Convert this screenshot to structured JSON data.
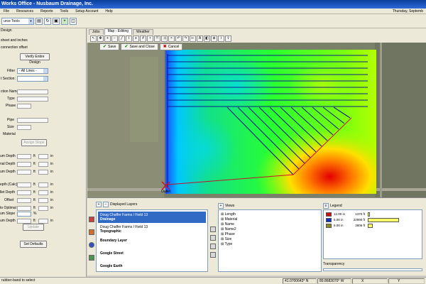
{
  "window": {
    "title": "Works Office - Nusbaum Drainage, Inc."
  },
  "menu": {
    "items": [
      "File",
      "Resources",
      "Reports",
      "Tools",
      "Setup Account",
      "Help"
    ],
    "date": "Thursday, Septemb"
  },
  "toolbar": {
    "dropdown_value": "urce Tools"
  },
  "left_panel": {
    "design_label": "Design",
    "sheet_label": "sheet and inches",
    "connection_label": "connection offset",
    "verify_button": "Verify Entire Design",
    "filter_label": "Filter",
    "filter_value": "- All Lines -",
    "section_label": "t Section:",
    "section_name_label": "ction Name:",
    "type_label": "Type",
    "phase_label": "Phase",
    "pipe_label": "Pipe",
    "size_label": "Size",
    "material_label": "Material",
    "assign_button": "Assign Slope",
    "rows": [
      {
        "label": "um Depth",
        "unit1": "ft",
        "unit2": "in"
      },
      {
        "label": "nal Depth",
        "unit1": "ft",
        "unit2": "in"
      },
      {
        "label": "um Depth",
        "unit1": "ft",
        "unit2": "in"
      },
      {
        "label": "epth (Calc)",
        "unit1": "ft",
        "unit2": "in"
      },
      {
        "label": "llet Depth",
        "unit1": "ft",
        "unit2": "in"
      },
      {
        "label": "Offset",
        "unit1": "ft",
        "unit2": "in"
      },
      {
        "label": "to Optimal",
        "unit1": "ft",
        "unit2": "in"
      },
      {
        "label": "um Depth",
        "unit1": "ft",
        "unit2": "in"
      }
    ],
    "slope_label": "um Slope",
    "slope_unit": "%",
    "update_button": "Update",
    "defaults_button": "Set Defaults"
  },
  "tabs": [
    {
      "label": "Jobs"
    },
    {
      "label": "Map - Editing"
    },
    {
      "label": "Weather"
    }
  ],
  "edit_bar": {
    "save": "Save",
    "save_close": "Save and Close",
    "cancel": "Cancel"
  },
  "map": {
    "outlet_label": "Outlet"
  },
  "layers_panel": {
    "title": "Displayed Layers",
    "items": [
      {
        "line1": "Doug Chaffer Farms / Field 13",
        "line2": "Drainage"
      },
      {
        "line1": "Doug Chaffer Farms / Field 13",
        "line2": "Topographic"
      },
      {
        "line1": "",
        "line2": "Boundary Layer"
      },
      {
        "line1": "",
        "line2": "Google Street"
      },
      {
        "line1": "",
        "line2": "Google Earth"
      }
    ]
  },
  "views_panel": {
    "title": "Views",
    "items": [
      "Length",
      "Material",
      "Name",
      "Name2",
      "Phase",
      "Size",
      "Type"
    ]
  },
  "legend_panel": {
    "title": "Legend",
    "rows": [
      {
        "size": "12.00 in",
        "length": "1370 ft",
        "color": "#cc1010",
        "share": 0.06
      },
      {
        "size": "5.00 in",
        "length": "22990 ft",
        "color": "#1030c0",
        "share": 1.0
      },
      {
        "size": "6.00 in",
        "length": "3606 ft",
        "color": "#8a8a2a",
        "share": 0.16
      }
    ],
    "transparency_label": "Transparency"
  },
  "status": {
    "message": "rubber-band to select",
    "lat": "41.0700643° N",
    "lon": "89.8683070° W",
    "x_label": "X",
    "y_label": "Y"
  },
  "colors": {
    "title_bar": "#0a3f9c",
    "selection": "#316ac5",
    "drain_line": "#0c1f8a"
  }
}
